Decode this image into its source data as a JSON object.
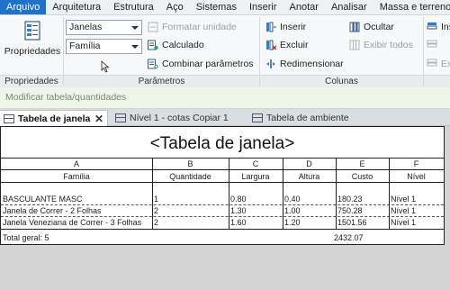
{
  "menu": {
    "items": [
      "Arquivo",
      "Arquitetura",
      "Estrutura",
      "Aço",
      "Sistemas",
      "Inserir",
      "Anotar",
      "Analisar",
      "Massa e terreno"
    ]
  },
  "ribbon": {
    "properties_button": "Propriedades",
    "type_dropdown": "Janelas",
    "family_dropdown": "Família",
    "format_unit": "Formatar unidade",
    "calculated": "Calculado",
    "combine_parameters": "Combinar parâmetros",
    "insert": "Inserir",
    "delete": "Excluir",
    "resize": "Redimensionar",
    "hide": "Ocultar",
    "show_all": "Exibir todos",
    "cut_right_1": "Ins",
    "cut_right_2": "Ex",
    "panels": {
      "properties": "Propriedades",
      "parameters": "Parâmetros",
      "columns": "Colunas"
    }
  },
  "context_label": "Modificar tabela/quantidades",
  "tabs": [
    {
      "label": "Tabela de janela"
    },
    {
      "label": "Nível 1 - cotas Copiar 1"
    },
    {
      "label": "Tabela de ambiente"
    }
  ],
  "schedule": {
    "title": "<Tabela de janela>",
    "column_letters": [
      "A",
      "B",
      "C",
      "D",
      "E",
      "F"
    ],
    "headers": [
      "Família",
      "Quantidade",
      "Largura",
      "Altura",
      "Custo",
      "Nível"
    ],
    "rows": [
      [
        "BASCULANTE MASC",
        "1",
        "0.80",
        "0.40",
        "180.23",
        "Nível 1"
      ],
      [
        "Janela de Correr - 2 Folhas",
        "2",
        "1.30",
        "1.00",
        "750.28",
        "Nível 1"
      ],
      [
        "Janela Veneziana de Correr - 3 Folhas",
        "2",
        "1.60",
        "1.20",
        "1501.56",
        "Nível 1"
      ]
    ],
    "total_label": "Total geral: 5",
    "total_cost": "2432.07"
  }
}
